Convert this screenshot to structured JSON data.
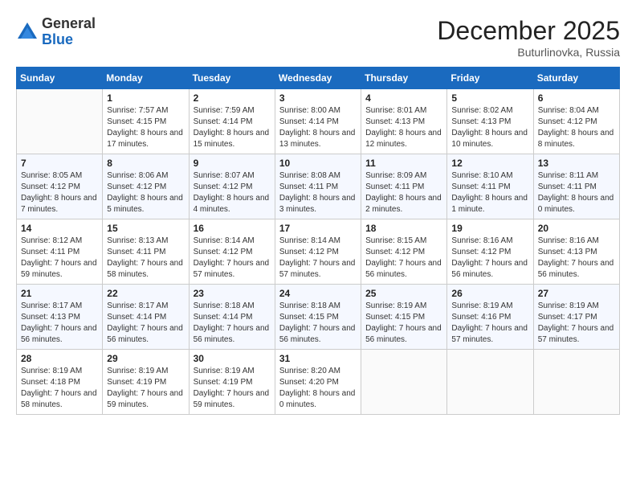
{
  "logo": {
    "general": "General",
    "blue": "Blue"
  },
  "title": "December 2025",
  "location": "Buturlinovka, Russia",
  "weekdays": [
    "Sunday",
    "Monday",
    "Tuesday",
    "Wednesday",
    "Thursday",
    "Friday",
    "Saturday"
  ],
  "weeks": [
    [
      {
        "day": "",
        "sunrise": "",
        "sunset": "",
        "daylight": ""
      },
      {
        "day": "1",
        "sunrise": "Sunrise: 7:57 AM",
        "sunset": "Sunset: 4:15 PM",
        "daylight": "Daylight: 8 hours and 17 minutes."
      },
      {
        "day": "2",
        "sunrise": "Sunrise: 7:59 AM",
        "sunset": "Sunset: 4:14 PM",
        "daylight": "Daylight: 8 hours and 15 minutes."
      },
      {
        "day": "3",
        "sunrise": "Sunrise: 8:00 AM",
        "sunset": "Sunset: 4:14 PM",
        "daylight": "Daylight: 8 hours and 13 minutes."
      },
      {
        "day": "4",
        "sunrise": "Sunrise: 8:01 AM",
        "sunset": "Sunset: 4:13 PM",
        "daylight": "Daylight: 8 hours and 12 minutes."
      },
      {
        "day": "5",
        "sunrise": "Sunrise: 8:02 AM",
        "sunset": "Sunset: 4:13 PM",
        "daylight": "Daylight: 8 hours and 10 minutes."
      },
      {
        "day": "6",
        "sunrise": "Sunrise: 8:04 AM",
        "sunset": "Sunset: 4:12 PM",
        "daylight": "Daylight: 8 hours and 8 minutes."
      }
    ],
    [
      {
        "day": "7",
        "sunrise": "Sunrise: 8:05 AM",
        "sunset": "Sunset: 4:12 PM",
        "daylight": "Daylight: 8 hours and 7 minutes."
      },
      {
        "day": "8",
        "sunrise": "Sunrise: 8:06 AM",
        "sunset": "Sunset: 4:12 PM",
        "daylight": "Daylight: 8 hours and 5 minutes."
      },
      {
        "day": "9",
        "sunrise": "Sunrise: 8:07 AM",
        "sunset": "Sunset: 4:12 PM",
        "daylight": "Daylight: 8 hours and 4 minutes."
      },
      {
        "day": "10",
        "sunrise": "Sunrise: 8:08 AM",
        "sunset": "Sunset: 4:11 PM",
        "daylight": "Daylight: 8 hours and 3 minutes."
      },
      {
        "day": "11",
        "sunrise": "Sunrise: 8:09 AM",
        "sunset": "Sunset: 4:11 PM",
        "daylight": "Daylight: 8 hours and 2 minutes."
      },
      {
        "day": "12",
        "sunrise": "Sunrise: 8:10 AM",
        "sunset": "Sunset: 4:11 PM",
        "daylight": "Daylight: 8 hours and 1 minute."
      },
      {
        "day": "13",
        "sunrise": "Sunrise: 8:11 AM",
        "sunset": "Sunset: 4:11 PM",
        "daylight": "Daylight: 8 hours and 0 minutes."
      }
    ],
    [
      {
        "day": "14",
        "sunrise": "Sunrise: 8:12 AM",
        "sunset": "Sunset: 4:11 PM",
        "daylight": "Daylight: 7 hours and 59 minutes."
      },
      {
        "day": "15",
        "sunrise": "Sunrise: 8:13 AM",
        "sunset": "Sunset: 4:11 PM",
        "daylight": "Daylight: 7 hours and 58 minutes."
      },
      {
        "day": "16",
        "sunrise": "Sunrise: 8:14 AM",
        "sunset": "Sunset: 4:12 PM",
        "daylight": "Daylight: 7 hours and 57 minutes."
      },
      {
        "day": "17",
        "sunrise": "Sunrise: 8:14 AM",
        "sunset": "Sunset: 4:12 PM",
        "daylight": "Daylight: 7 hours and 57 minutes."
      },
      {
        "day": "18",
        "sunrise": "Sunrise: 8:15 AM",
        "sunset": "Sunset: 4:12 PM",
        "daylight": "Daylight: 7 hours and 56 minutes."
      },
      {
        "day": "19",
        "sunrise": "Sunrise: 8:16 AM",
        "sunset": "Sunset: 4:12 PM",
        "daylight": "Daylight: 7 hours and 56 minutes."
      },
      {
        "day": "20",
        "sunrise": "Sunrise: 8:16 AM",
        "sunset": "Sunset: 4:13 PM",
        "daylight": "Daylight: 7 hours and 56 minutes."
      }
    ],
    [
      {
        "day": "21",
        "sunrise": "Sunrise: 8:17 AM",
        "sunset": "Sunset: 4:13 PM",
        "daylight": "Daylight: 7 hours and 56 minutes."
      },
      {
        "day": "22",
        "sunrise": "Sunrise: 8:17 AM",
        "sunset": "Sunset: 4:14 PM",
        "daylight": "Daylight: 7 hours and 56 minutes."
      },
      {
        "day": "23",
        "sunrise": "Sunrise: 8:18 AM",
        "sunset": "Sunset: 4:14 PM",
        "daylight": "Daylight: 7 hours and 56 minutes."
      },
      {
        "day": "24",
        "sunrise": "Sunrise: 8:18 AM",
        "sunset": "Sunset: 4:15 PM",
        "daylight": "Daylight: 7 hours and 56 minutes."
      },
      {
        "day": "25",
        "sunrise": "Sunrise: 8:19 AM",
        "sunset": "Sunset: 4:15 PM",
        "daylight": "Daylight: 7 hours and 56 minutes."
      },
      {
        "day": "26",
        "sunrise": "Sunrise: 8:19 AM",
        "sunset": "Sunset: 4:16 PM",
        "daylight": "Daylight: 7 hours and 57 minutes."
      },
      {
        "day": "27",
        "sunrise": "Sunrise: 8:19 AM",
        "sunset": "Sunset: 4:17 PM",
        "daylight": "Daylight: 7 hours and 57 minutes."
      }
    ],
    [
      {
        "day": "28",
        "sunrise": "Sunrise: 8:19 AM",
        "sunset": "Sunset: 4:18 PM",
        "daylight": "Daylight: 7 hours and 58 minutes."
      },
      {
        "day": "29",
        "sunrise": "Sunrise: 8:19 AM",
        "sunset": "Sunset: 4:19 PM",
        "daylight": "Daylight: 7 hours and 59 minutes."
      },
      {
        "day": "30",
        "sunrise": "Sunrise: 8:19 AM",
        "sunset": "Sunset: 4:19 PM",
        "daylight": "Daylight: 7 hours and 59 minutes."
      },
      {
        "day": "31",
        "sunrise": "Sunrise: 8:20 AM",
        "sunset": "Sunset: 4:20 PM",
        "daylight": "Daylight: 8 hours and 0 minutes."
      },
      {
        "day": "",
        "sunrise": "",
        "sunset": "",
        "daylight": ""
      },
      {
        "day": "",
        "sunrise": "",
        "sunset": "",
        "daylight": ""
      },
      {
        "day": "",
        "sunrise": "",
        "sunset": "",
        "daylight": ""
      }
    ]
  ]
}
